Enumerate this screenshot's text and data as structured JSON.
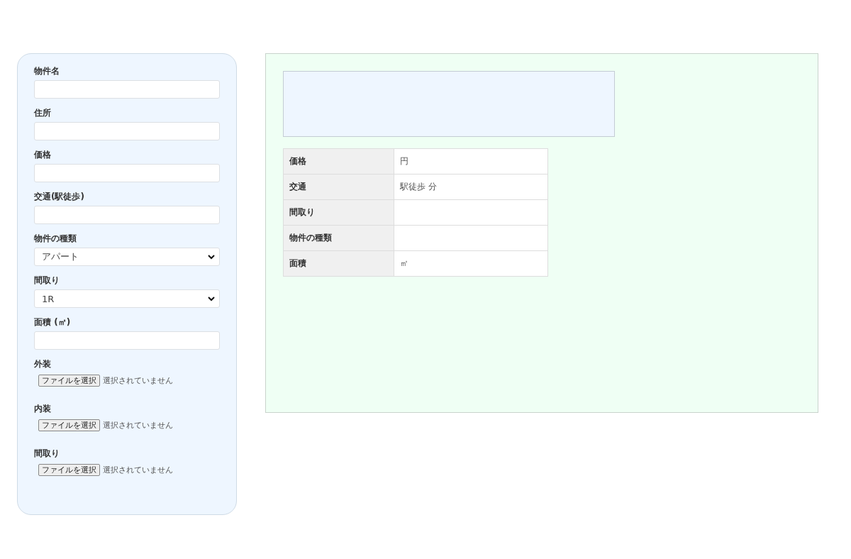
{
  "form": {
    "fields": [
      {
        "kind": "text",
        "label": "物件名"
      },
      {
        "kind": "text",
        "label": "住所"
      },
      {
        "kind": "text",
        "label": "価格"
      },
      {
        "kind": "text",
        "label": "交通(駅徒歩)"
      },
      {
        "kind": "select",
        "label": "物件の種類",
        "value": "アパート"
      },
      {
        "kind": "select",
        "label": "間取り",
        "value": "1R"
      },
      {
        "kind": "text",
        "label": "面積 (㎡)"
      },
      {
        "kind": "file",
        "label": "外装",
        "button": "ファイルを選択",
        "status": "選択されていません"
      },
      {
        "kind": "file",
        "label": "内装",
        "button": "ファイルを選択",
        "status": "選択されていません"
      },
      {
        "kind": "file",
        "label": "間取り",
        "button": "ファイルを選択",
        "status": "選択されていません"
      }
    ]
  },
  "preview": {
    "table": [
      {
        "label": "価格",
        "value": "円"
      },
      {
        "label": "交通",
        "value": "駅徒歩 分"
      },
      {
        "label": "間取り"
      },
      {
        "label": "物件の種類"
      },
      {
        "label": "面積",
        "value": "㎡"
      }
    ]
  }
}
